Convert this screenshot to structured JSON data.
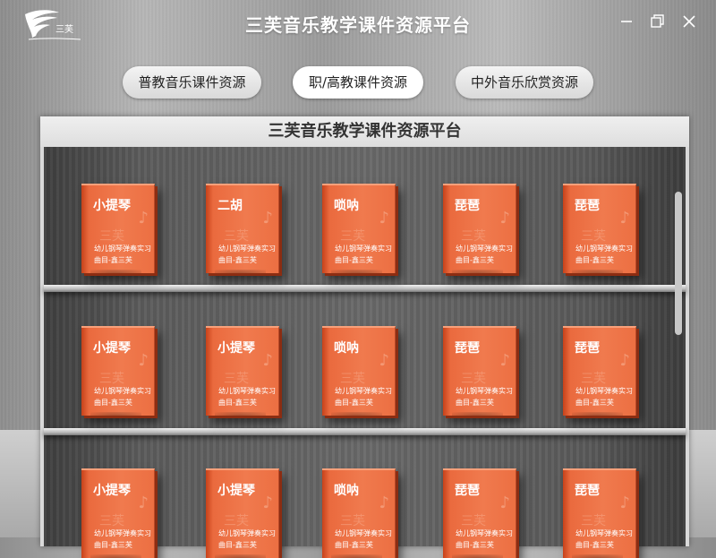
{
  "app": {
    "title": "三芙音乐教学课件资源平台",
    "logo_text": "三芙"
  },
  "window_controls": [
    "minimize",
    "maximize",
    "close"
  ],
  "tabs": [
    {
      "label": "普教音乐课件资源",
      "active": false
    },
    {
      "label": "职/高教课件资源",
      "active": true
    },
    {
      "label": "中外音乐欣赏资源",
      "active": false
    }
  ],
  "cabinet": {
    "title": "三芙音乐教学课件资源平台"
  },
  "shelves": [
    {
      "books": [
        {
          "title": "小提琴",
          "line1": "幼儿钢琴弹奏实习",
          "line2": "曲目-鑫三芙"
        },
        {
          "title": "二胡",
          "line1": "幼儿钢琴弹奏实习",
          "line2": "曲目-鑫三芙"
        },
        {
          "title": "唢呐",
          "line1": "幼儿钢琴弹奏实习",
          "line2": "曲目-鑫三芙"
        },
        {
          "title": "琵琶",
          "line1": "幼儿钢琴弹奏实习",
          "line2": "曲目-鑫三芙"
        },
        {
          "title": "琵琶",
          "line1": "幼儿钢琴弹奏实习",
          "line2": "曲目-鑫三芙"
        }
      ]
    },
    {
      "books": [
        {
          "title": "小提琴",
          "line1": "幼儿钢琴弹奏实习",
          "line2": "曲目-鑫三芙"
        },
        {
          "title": "小提琴",
          "line1": "幼儿钢琴弹奏实习",
          "line2": "曲目-鑫三芙"
        },
        {
          "title": "唢呐",
          "line1": "幼儿钢琴弹奏实习",
          "line2": "曲目-鑫三芙"
        },
        {
          "title": "琵琶",
          "line1": "幼儿钢琴弹奏实习",
          "line2": "曲目-鑫三芙"
        },
        {
          "title": "琵琶",
          "line1": "幼儿钢琴弹奏实习",
          "line2": "曲目-鑫三芙"
        }
      ]
    },
    {
      "books": [
        {
          "title": "小提琴",
          "line1": "幼儿钢琴弹奏实习",
          "line2": "曲目-鑫三芙"
        },
        {
          "title": "小提琴",
          "line1": "幼儿钢琴弹奏实习",
          "line2": "曲目-鑫三芙"
        },
        {
          "title": "唢呐",
          "line1": "幼儿钢琴弹奏实习",
          "line2": "曲目-鑫三芙"
        },
        {
          "title": "琵琶",
          "line1": "幼儿钢琴弹奏实习",
          "line2": "曲目-鑫三芙"
        },
        {
          "title": "琵琶",
          "line1": "幼儿钢琴弹奏实习",
          "line2": "曲目-鑫三芙"
        }
      ]
    }
  ],
  "colors": {
    "book_accent": "#ec6f42",
    "book_shadow": "#8c2d12"
  }
}
